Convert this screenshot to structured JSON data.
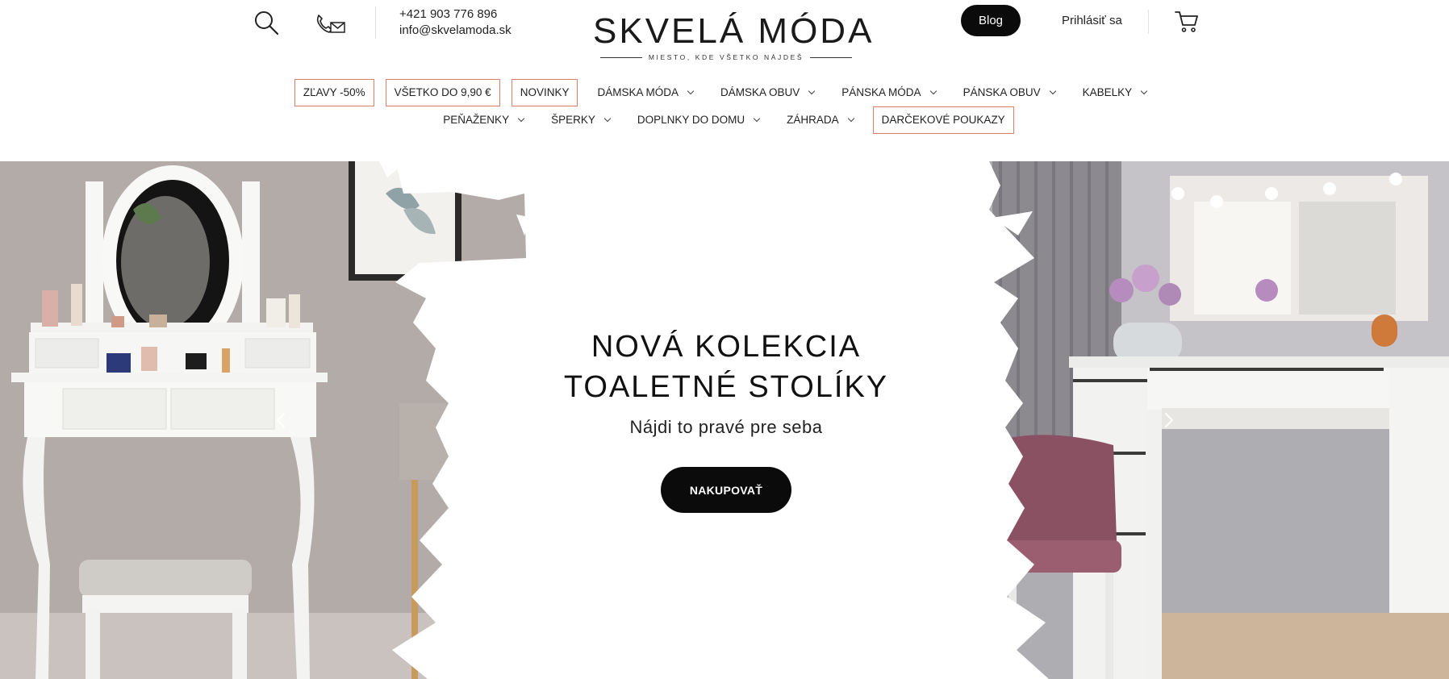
{
  "header": {
    "phone": "+421 903 776 896",
    "email": "info@skvelamoda.sk",
    "logo_title": "SKVELÁ MÓDA",
    "logo_tagline": "MIESTO, KDE VŠETKO NÁJDEŠ",
    "blog_label": "Blog",
    "login_label": "Prihlásiť sa",
    "icons": [
      "search-icon",
      "contact-icon",
      "cart-icon"
    ]
  },
  "nav": {
    "row1": [
      {
        "label": "ZĽAVY -50%",
        "boxed": true,
        "dropdown": false
      },
      {
        "label": "VŠETKO DO 9,90 €",
        "boxed": true,
        "dropdown": false
      },
      {
        "label": "NOVINKY",
        "boxed": true,
        "dropdown": false
      },
      {
        "label": "DÁMSKA MÓDA",
        "boxed": false,
        "dropdown": true
      },
      {
        "label": "DÁMSKA OBUV",
        "boxed": false,
        "dropdown": true
      },
      {
        "label": "PÁNSKA MÓDA",
        "boxed": false,
        "dropdown": true
      },
      {
        "label": "PÁNSKA OBUV",
        "boxed": false,
        "dropdown": true
      },
      {
        "label": "KABELKY",
        "boxed": false,
        "dropdown": true
      }
    ],
    "row2": [
      {
        "label": "PEŇAŽENKY",
        "boxed": false,
        "dropdown": true
      },
      {
        "label": "ŠPERKY",
        "boxed": false,
        "dropdown": true
      },
      {
        "label": "DOPLNKY DO DOMU",
        "boxed": false,
        "dropdown": true
      },
      {
        "label": "ZÁHRADA",
        "boxed": false,
        "dropdown": true
      },
      {
        "label": "DARČEKOVÉ POUKAZY",
        "boxed": true,
        "dropdown": false
      }
    ]
  },
  "hero": {
    "title_line1": "NOVÁ KOLEKCIA",
    "title_line2": "TOALETNÉ STOLÍKY",
    "subtitle": "Nájdi to pravé pre seba",
    "cta_label": "NAKUPOVAŤ"
  },
  "colors": {
    "accent_border": "#d9806a",
    "button_bg": "#0b0b0b",
    "text": "#111111"
  }
}
